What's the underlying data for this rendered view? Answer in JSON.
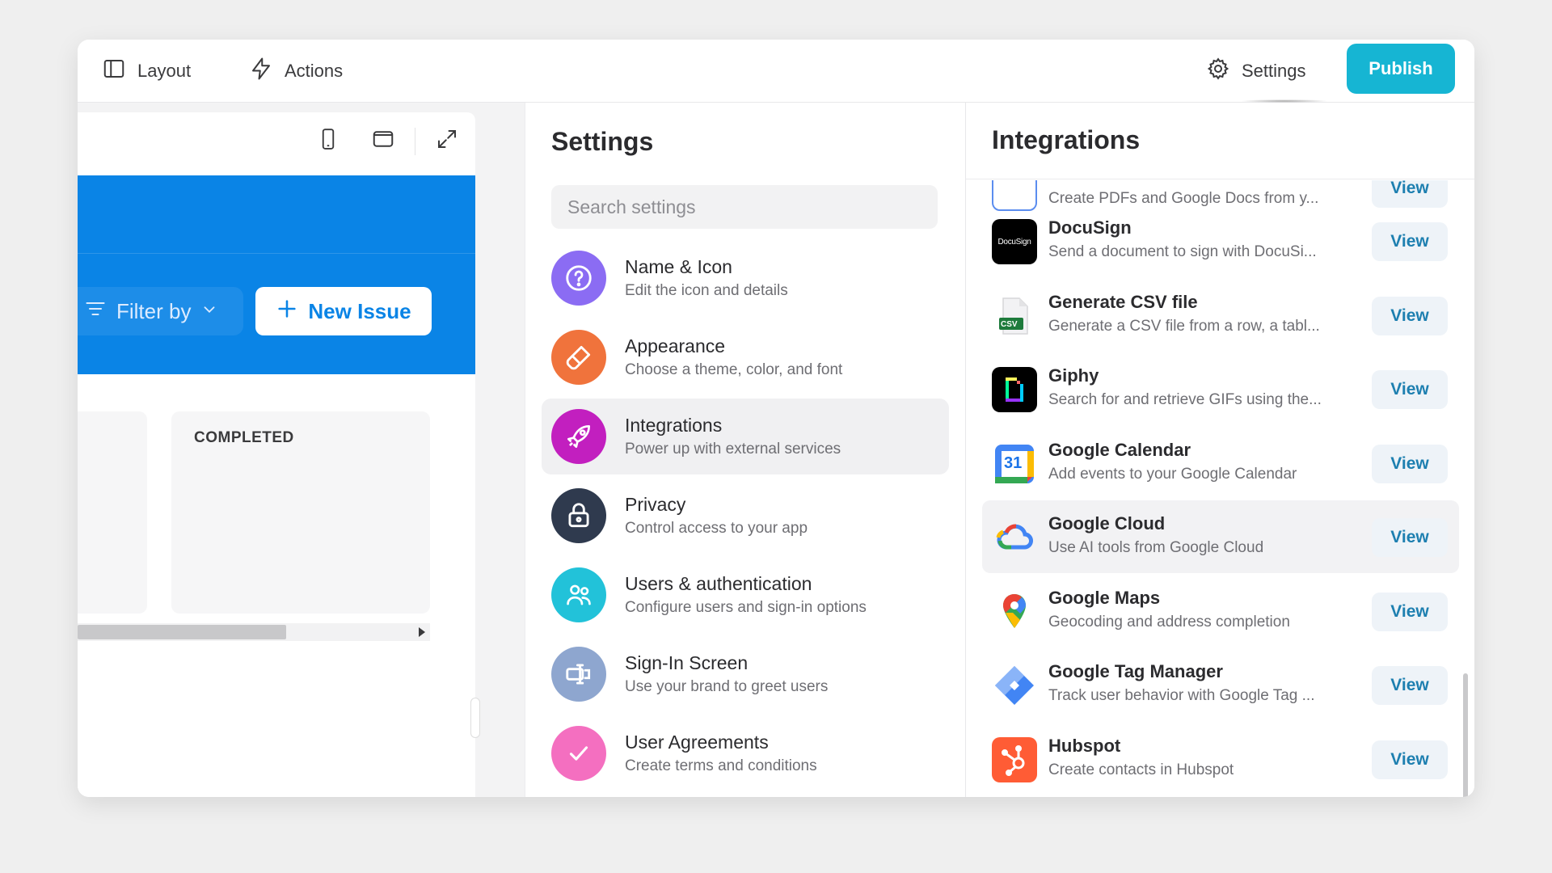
{
  "topbar": {
    "layout_label": "Layout",
    "actions_label": "Actions",
    "settings_label": "Settings",
    "publish_label": "Publish"
  },
  "preview": {
    "filter_label": "Filter by",
    "new_issue_label": "New Issue",
    "column_title": "COMPLETED"
  },
  "settings": {
    "title": "Settings",
    "search_placeholder": "Search settings",
    "items": [
      {
        "title": "Name & Icon",
        "subtitle": "Edit the icon and details",
        "color": "#8b6cf3",
        "icon": "question-icon"
      },
      {
        "title": "Appearance",
        "subtitle": "Choose a theme, color, and font",
        "color": "#f0733c",
        "icon": "brush-icon"
      },
      {
        "title": "Integrations",
        "subtitle": "Power up with external services",
        "color": "#c21fbf",
        "icon": "rocket-icon"
      },
      {
        "title": "Privacy",
        "subtitle": "Control access to your app",
        "color": "#2f3a4e",
        "icon": "lock-icon"
      },
      {
        "title": "Users & authentication",
        "subtitle": "Configure users and sign-in options",
        "color": "#22c2d9",
        "icon": "users-icon"
      },
      {
        "title": "Sign-In Screen",
        "subtitle": "Use your brand to greet users",
        "color": "#8ea6cf",
        "icon": "sign-in-icon"
      },
      {
        "title": "User Agreements",
        "subtitle": "Create terms and conditions",
        "color": "#f46fc0",
        "icon": "check-icon"
      }
    ]
  },
  "integrations": {
    "title": "Integrations",
    "partial_sub": "Create PDFs and Google Docs from y...",
    "view_label": "View",
    "items": [
      {
        "title": "DocuSign",
        "subtitle": "Send a document to sign with DocuSi...",
        "logo_text": "DocuSign"
      },
      {
        "title": "Generate CSV file",
        "subtitle": "Generate a CSV file from a row, a tabl...",
        "logo_text": "CSV"
      },
      {
        "title": "Giphy",
        "subtitle": "Search for and retrieve GIFs using the..."
      },
      {
        "title": "Google Calendar",
        "subtitle": "Add events to your Google Calendar",
        "logo_text": "31"
      },
      {
        "title": "Google Cloud",
        "subtitle": "Use AI tools from Google Cloud"
      },
      {
        "title": "Google Maps",
        "subtitle": "Geocoding and address completion"
      },
      {
        "title": "Google Tag Manager",
        "subtitle": "Track user behavior with Google Tag ..."
      },
      {
        "title": "Hubspot",
        "subtitle": "Create contacts in Hubspot"
      }
    ]
  }
}
